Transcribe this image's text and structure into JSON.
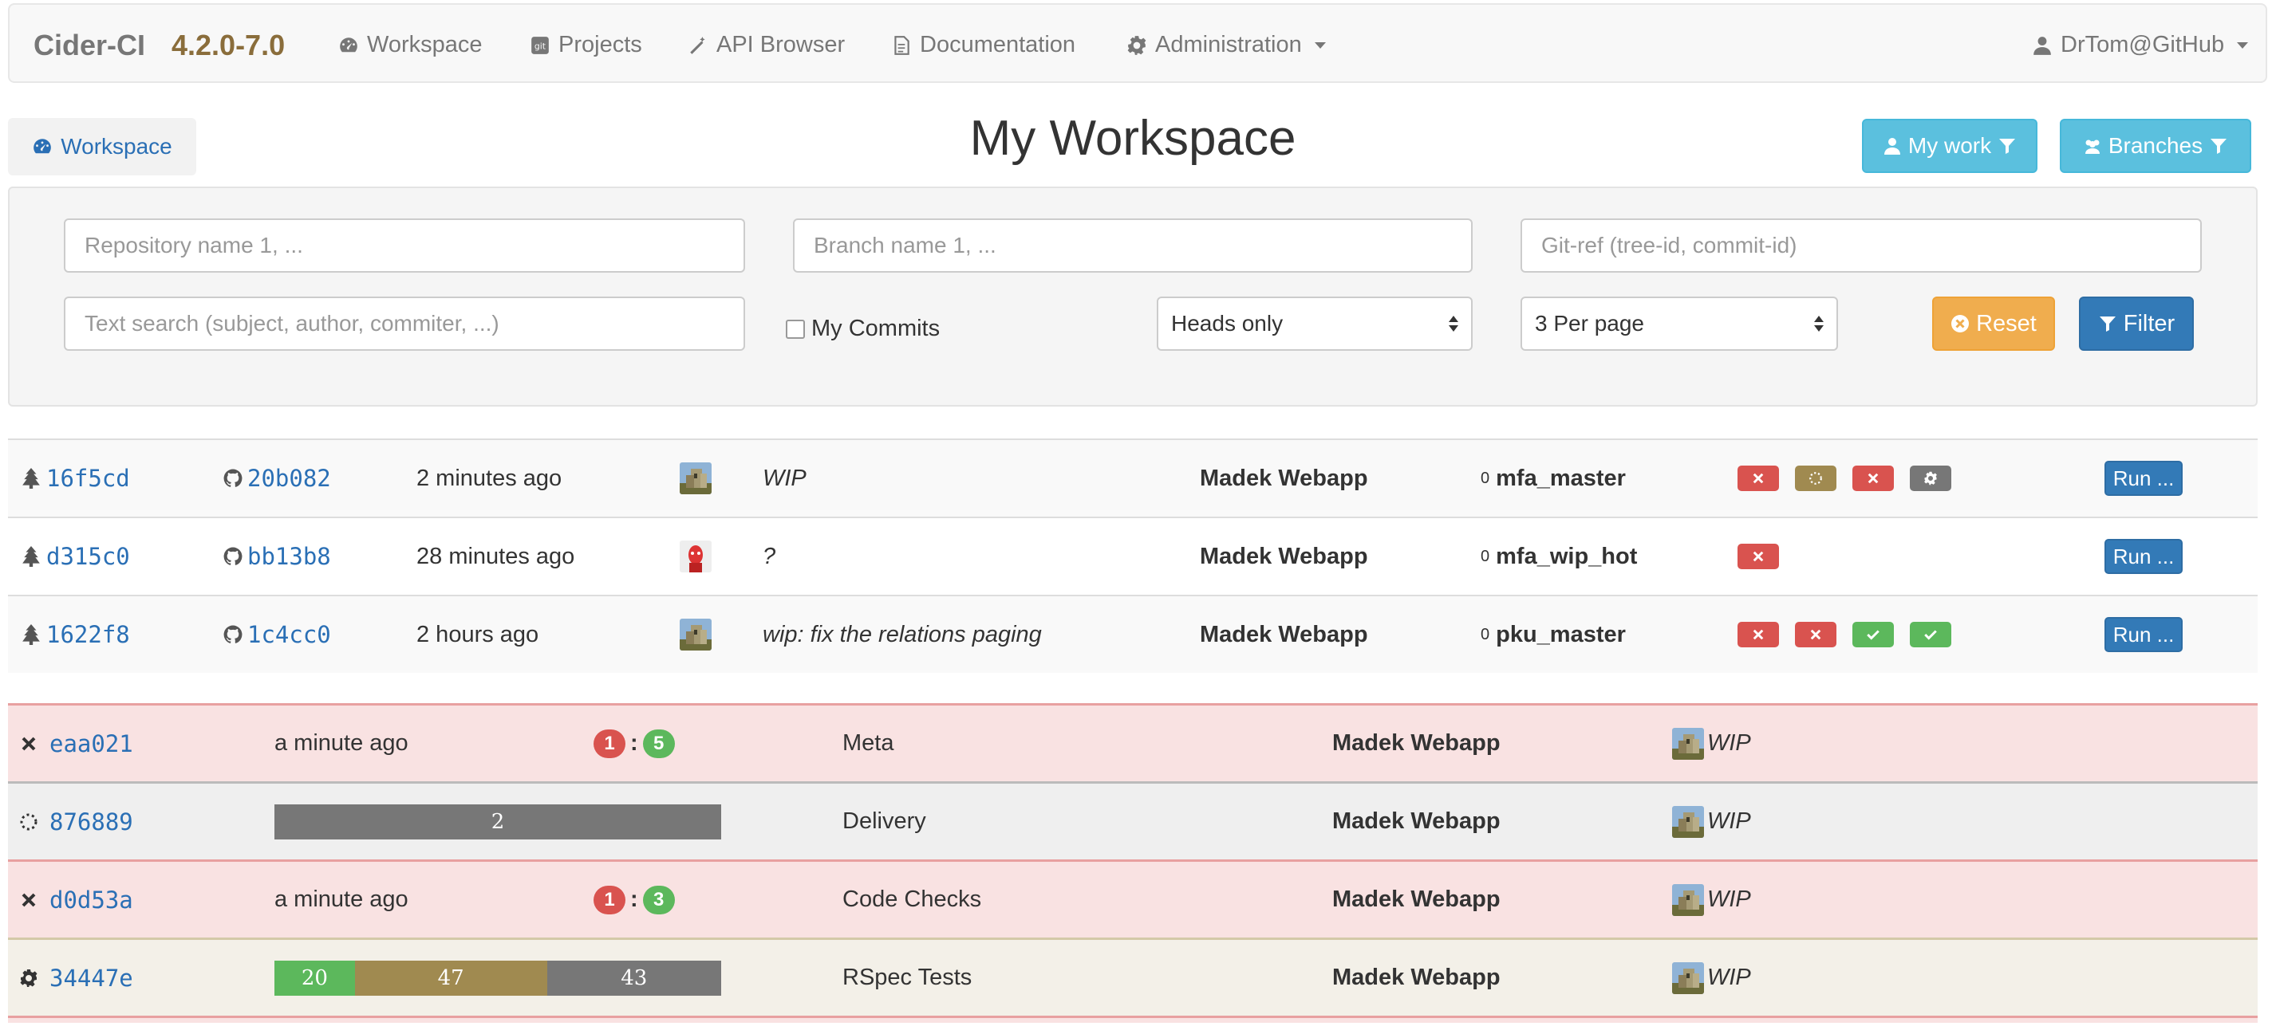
{
  "navbar": {
    "brand": "Cider-CI",
    "version": "4.2.0-7.0",
    "items": [
      {
        "label": "Workspace",
        "icon": "dashboard-icon"
      },
      {
        "label": "Projects",
        "icon": "git-icon"
      },
      {
        "label": "API Browser",
        "icon": "magic-wand-icon"
      },
      {
        "label": "Documentation",
        "icon": "document-icon"
      },
      {
        "label": "Administration",
        "icon": "gear-icon"
      }
    ],
    "user": "DrTom@GitHub"
  },
  "header": {
    "breadcrumb": "Workspace",
    "title": "My Workspace",
    "my_work_button": "My work",
    "branches_button": "Branches"
  },
  "filter": {
    "repository_placeholder": "Repository name 1, ...",
    "branch_placeholder": "Branch name 1, ...",
    "git_ref_placeholder": "Git-ref (tree-id, commit-id)",
    "text_search_placeholder": "Text search (subject, author, commiter, ...)",
    "my_commits_label": "My Commits",
    "heads_select": "Heads only",
    "per_page_select": "3 Per page",
    "reset_button": "Reset",
    "filter_button": "Filter"
  },
  "commits": [
    {
      "tree_id": "16f5cd",
      "commit_id": "20b082",
      "time": "2 minutes ago",
      "avatar": "castle-avatar",
      "subject": "WIP",
      "project": "Madek Webapp",
      "branch_depth": "0",
      "branch": "mfa_master",
      "statuses": [
        "failed",
        "executing",
        "failed",
        "pending"
      ],
      "run_label": "Run ..."
    },
    {
      "tree_id": "d315c0",
      "commit_id": "bb13b8",
      "time": "28 minutes ago",
      "avatar": "red-face-avatar",
      "subject": "?",
      "project": "Madek Webapp",
      "branch_depth": "0",
      "branch": "mfa_wip_hot",
      "statuses": [
        "failed"
      ],
      "run_label": "Run ..."
    },
    {
      "tree_id": "1622f8",
      "commit_id": "1c4cc0",
      "time": "2 hours ago",
      "avatar": "castle-avatar",
      "subject": "wip: fix the relations paging",
      "project": "Madek Webapp",
      "branch_depth": "0",
      "branch": "pku_master",
      "statuses": [
        "failed",
        "failed",
        "passed",
        "passed"
      ],
      "run_label": "Run ..."
    }
  ],
  "jobs": [
    {
      "state": "failed",
      "id": "eaa021",
      "time": "a minute ago",
      "failed_count": "1",
      "passed_count": "5",
      "name": "Meta",
      "project": "Madek Webapp",
      "subject": "WIP"
    },
    {
      "state": "executing",
      "id": "876889",
      "progress": [
        {
          "kind": "pending",
          "value": "2",
          "fraction": 1.0
        }
      ],
      "name": "Delivery",
      "project": "Madek Webapp",
      "subject": "WIP"
    },
    {
      "state": "failed",
      "id": "d0d53a",
      "time": "a minute ago",
      "failed_count": "1",
      "passed_count": "3",
      "name": "Code Checks",
      "project": "Madek Webapp",
      "subject": "WIP"
    },
    {
      "state": "pending",
      "id": "34447e",
      "progress": [
        {
          "kind": "passed",
          "value": "20",
          "fraction": 0.18
        },
        {
          "kind": "executing",
          "value": "47",
          "fraction": 0.43
        },
        {
          "kind": "pending",
          "value": "43",
          "fraction": 0.39
        }
      ],
      "name": "RSpec Tests",
      "project": "Madek Webapp",
      "subject": "WIP"
    }
  ],
  "colors": {
    "failed": "#d9534f",
    "passed": "#5cb85c",
    "executing": "#a08a50",
    "pending": "#777777",
    "info": "#5bc0de",
    "primary": "#337ab7",
    "warning": "#f0ad4e"
  }
}
